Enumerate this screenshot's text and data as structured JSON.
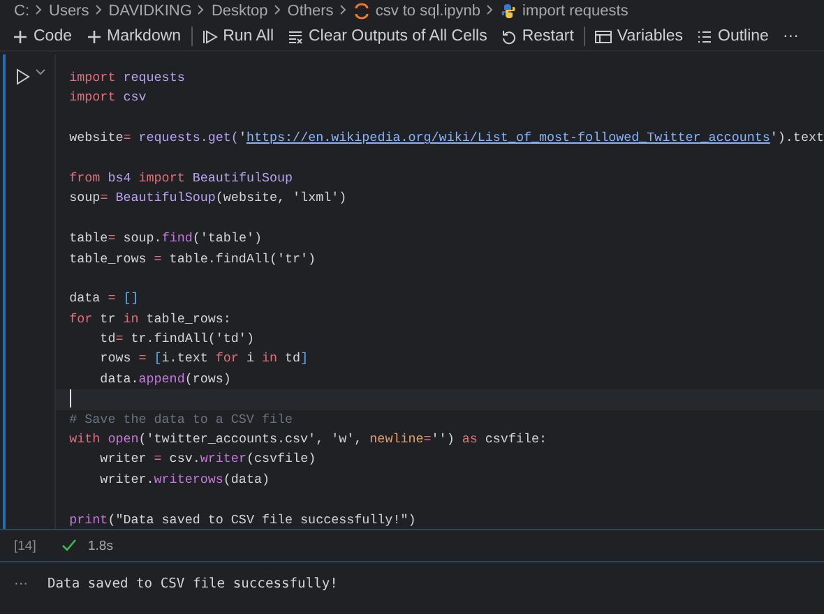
{
  "breadcrumb": [
    {
      "label": "C:",
      "kind": "text"
    },
    {
      "label": "Users",
      "kind": "text"
    },
    {
      "label": "DAVIDKING",
      "kind": "text"
    },
    {
      "label": "Desktop",
      "kind": "text"
    },
    {
      "label": "Others",
      "kind": "text"
    },
    {
      "label": "csv to sql.ipynb",
      "kind": "notebook"
    },
    {
      "label": "import requests",
      "kind": "python"
    }
  ],
  "toolbar_groups": [
    [
      {
        "label": "Code",
        "kind": "plus"
      },
      {
        "label": "Markdown",
        "kind": "plus"
      }
    ],
    [
      {
        "label": "Run All",
        "kind": "run"
      },
      {
        "label": "Clear Outputs of All Cells",
        "kind": "clear"
      },
      {
        "label": "Restart",
        "kind": "restart"
      }
    ],
    [
      {
        "label": "Variables",
        "kind": "variables"
      },
      {
        "label": "Outline",
        "kind": "outline"
      },
      {
        "label": "···",
        "kind": "more"
      }
    ]
  ],
  "cell": {
    "lines": [
      {
        "kind": "code",
        "tokens": [
          {
            "t": "import",
            "kind": "kw"
          },
          {
            "t": " requests",
            "kind": "mod"
          }
        ]
      },
      {
        "kind": "code",
        "tokens": [
          {
            "t": "import",
            "kind": "kw"
          },
          {
            "t": " csv",
            "kind": "mod"
          }
        ]
      },
      {
        "kind": "blank",
        "selected": false
      },
      {
        "kind": "code",
        "tokens": [
          {
            "t": "website",
            "kind": "plain"
          },
          {
            "t": "=",
            "kind": "kw"
          },
          {
            "t": " requests.get(",
            "kind": "mod"
          },
          {
            "t": "'",
            "kind": "str"
          },
          {
            "t": "https://en.wikipedia.org/wiki/List_of_most-followed_Twitter_accounts",
            "kind": "url"
          },
          {
            "t": "').text",
            "kind": "plain"
          }
        ]
      },
      {
        "kind": "blank",
        "selected": false
      },
      {
        "kind": "code",
        "tokens": [
          {
            "t": "from",
            "kind": "kw"
          },
          {
            "t": " bs4 ",
            "kind": "mod"
          },
          {
            "t": "import",
            "kind": "kw"
          },
          {
            "t": " BeautifulSoup",
            "kind": "mod"
          }
        ]
      },
      {
        "kind": "code",
        "tokens": [
          {
            "t": "soup",
            "kind": "plain"
          },
          {
            "t": "=",
            "kind": "kw"
          },
          {
            "t": " BeautifulSoup",
            "kind": "mod"
          },
          {
            "t": "(website, 'lxml')",
            "kind": "plain"
          }
        ]
      },
      {
        "kind": "blank",
        "selected": false
      },
      {
        "kind": "code",
        "tokens": [
          {
            "t": "table",
            "kind": "plain"
          },
          {
            "t": "=",
            "kind": "kw"
          },
          {
            "t": " soup.",
            "kind": "plain"
          },
          {
            "t": "find",
            "kind": "fn"
          },
          {
            "t": "('table')",
            "kind": "plain"
          }
        ]
      },
      {
        "kind": "code",
        "tokens": [
          {
            "t": "table_rows ",
            "kind": "plain"
          },
          {
            "t": "=",
            "kind": "kw"
          },
          {
            "t": " table.findAll('tr')",
            "kind": "plain"
          }
        ]
      },
      {
        "kind": "blank",
        "selected": false
      },
      {
        "kind": "code",
        "tokens": [
          {
            "t": "data ",
            "kind": "plain"
          },
          {
            "t": "=",
            "kind": "kw"
          },
          {
            "t": " []",
            "kind": "punct"
          }
        ]
      },
      {
        "kind": "code",
        "tokens": [
          {
            "t": "for",
            "kind": "kw"
          },
          {
            "t": " tr ",
            "kind": "plain"
          },
          {
            "t": "in",
            "kind": "kw"
          },
          {
            "t": " table_rows:",
            "kind": "plain"
          }
        ]
      },
      {
        "kind": "code",
        "tokens": [
          {
            "t": "    td",
            "kind": "plain"
          },
          {
            "t": "=",
            "kind": "kw"
          },
          {
            "t": " tr.findAll('td')",
            "kind": "plain"
          }
        ]
      },
      {
        "kind": "code",
        "tokens": [
          {
            "t": "    rows ",
            "kind": "plain"
          },
          {
            "t": "=",
            "kind": "kw"
          },
          {
            "t": " [",
            "kind": "punct"
          },
          {
            "t": "i.text ",
            "kind": "plain"
          },
          {
            "t": "for",
            "kind": "kw"
          },
          {
            "t": " i ",
            "kind": "plain"
          },
          {
            "t": "in",
            "kind": "kw"
          },
          {
            "t": " td",
            "kind": "plain"
          },
          {
            "t": "]",
            "kind": "punct"
          }
        ]
      },
      {
        "kind": "code",
        "tokens": [
          {
            "t": "    data.",
            "kind": "plain"
          },
          {
            "t": "append",
            "kind": "fn"
          },
          {
            "t": "(rows)",
            "kind": "plain"
          }
        ]
      },
      {
        "kind": "blank",
        "selected": true
      },
      {
        "kind": "code",
        "tokens": [
          {
            "t": "# Save the data to a CSV file",
            "kind": "comment"
          }
        ]
      },
      {
        "kind": "code",
        "tokens": [
          {
            "t": "with",
            "kind": "kw"
          },
          {
            "t": " open",
            "kind": "fn"
          },
          {
            "t": "('twitter_accounts.csv', 'w', ",
            "kind": "plain"
          },
          {
            "t": "newline",
            "kind": "param"
          },
          {
            "t": "=",
            "kind": "kw"
          },
          {
            "t": "'')",
            "kind": "plain"
          },
          {
            "t": " as",
            "kind": "kw"
          },
          {
            "t": " csvfile:",
            "kind": "plain"
          }
        ]
      },
      {
        "kind": "code",
        "tokens": [
          {
            "t": "    writer ",
            "kind": "plain"
          },
          {
            "t": "=",
            "kind": "kw"
          },
          {
            "t": " csv.",
            "kind": "plain"
          },
          {
            "t": "writer",
            "kind": "fn"
          },
          {
            "t": "(csvfile)",
            "kind": "plain"
          }
        ]
      },
      {
        "kind": "code",
        "tokens": [
          {
            "t": "    writer.",
            "kind": "plain"
          },
          {
            "t": "writerows",
            "kind": "fn"
          },
          {
            "t": "(data)",
            "kind": "plain"
          }
        ]
      },
      {
        "kind": "blank",
        "selected": false
      },
      {
        "kind": "code",
        "tokens": [
          {
            "t": "print",
            "kind": "fn"
          },
          {
            "t": "(\"Data saved to CSV file successfully!\")",
            "kind": "plain"
          }
        ]
      }
    ],
    "execution_count": "[14]",
    "succeeded": true,
    "duration": "1.8s",
    "output_menu": "···",
    "output": "Data saved to CSV file successfully!"
  }
}
